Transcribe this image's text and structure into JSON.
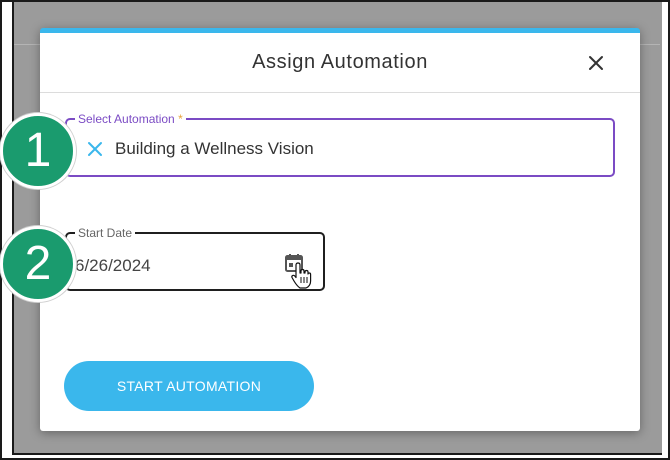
{
  "dialog": {
    "title": "Assign Automation",
    "close_label": "close"
  },
  "automation_field": {
    "label": "Select Automation",
    "required_mark": "*",
    "value": "Building a Wellness Vision"
  },
  "date_field": {
    "label": "Start Date",
    "value": "6/26/2024"
  },
  "actions": {
    "start_label": "START AUTOMATION"
  },
  "steps": {
    "one": "1",
    "two": "2"
  },
  "colors": {
    "accent": "#3ab7ec",
    "focus": "#7b4bc4",
    "step_badge": "#1a9b6e",
    "required": "#e8a33a"
  },
  "icons": {
    "close": "close-icon",
    "clear": "clear-icon",
    "calendar": "calendar-icon",
    "cursor": "hand-cursor-icon"
  }
}
